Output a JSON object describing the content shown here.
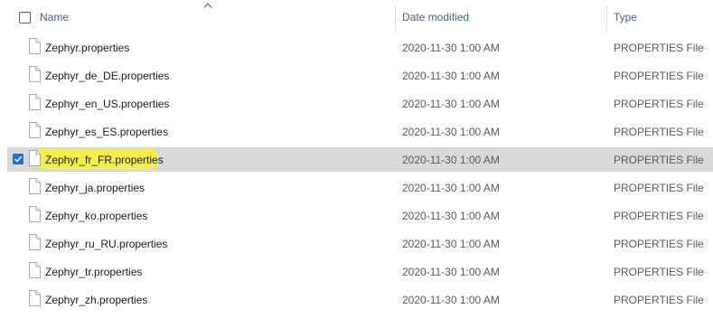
{
  "header": {
    "name_label": "Name",
    "date_label": "Date modified",
    "type_label": "Type",
    "sort_direction": "ascending"
  },
  "colors": {
    "selection_bg": "#d9d9d9",
    "highlight_marker": "#f4f03a",
    "checkbox_accent": "#2f6fbf",
    "header_text": "#4c607a"
  },
  "files": [
    {
      "name": "Zephyr.properties",
      "date": "2020-11-30 1:00 AM",
      "type": "PROPERTIES File",
      "selected": false,
      "icon": "file-icon"
    },
    {
      "name": "Zephyr_de_DE.properties",
      "date": "2020-11-30 1:00 AM",
      "type": "PROPERTIES File",
      "selected": false,
      "icon": "file-icon"
    },
    {
      "name": "Zephyr_en_US.properties",
      "date": "2020-11-30 1:00 AM",
      "type": "PROPERTIES File",
      "selected": false,
      "icon": "file-icon"
    },
    {
      "name": "Zephyr_es_ES.properties",
      "date": "2020-11-30 1:00 AM",
      "type": "PROPERTIES File",
      "selected": false,
      "icon": "file-icon"
    },
    {
      "name": "Zephyr_fr_FR.properties",
      "date": "2020-11-30 1:00 AM",
      "type": "PROPERTIES File",
      "selected": true,
      "icon": "file-icon"
    },
    {
      "name": "Zephyr_ja.properties",
      "date": "2020-11-30 1:00 AM",
      "type": "PROPERTIES File",
      "selected": false,
      "icon": "file-icon"
    },
    {
      "name": "Zephyr_ko.properties",
      "date": "2020-11-30 1:00 AM",
      "type": "PROPERTIES File",
      "selected": false,
      "icon": "file-icon"
    },
    {
      "name": "Zephyr_ru_RU.properties",
      "date": "2020-11-30 1:00 AM",
      "type": "PROPERTIES File",
      "selected": false,
      "icon": "file-icon"
    },
    {
      "name": "Zephyr_tr.properties",
      "date": "2020-11-30 1:00 AM",
      "type": "PROPERTIES File",
      "selected": false,
      "icon": "file-icon"
    },
    {
      "name": "Zephyr_zh.properties",
      "date": "2020-11-30 1:00 AM",
      "type": "PROPERTIES File",
      "selected": false,
      "icon": "file-icon"
    }
  ]
}
